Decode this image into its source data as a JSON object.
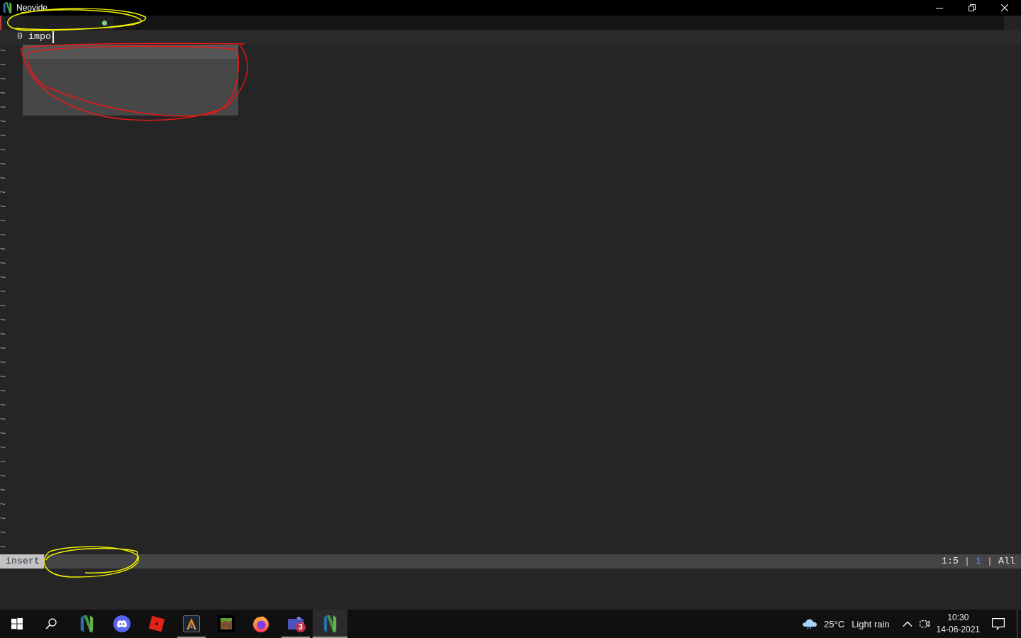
{
  "window": {
    "title": "Neovide"
  },
  "tabline": {
    "tabs": [
      {
        "selected": true,
        "modified": true
      }
    ]
  },
  "buffer": {
    "lines": [
      {
        "number": "0",
        "text": "impo",
        "cursor": true
      }
    ],
    "filler": [
      "~",
      "~",
      "~",
      "~",
      "~",
      "~",
      "~",
      "~",
      "~",
      "~",
      "~",
      "~",
      "~",
      "~",
      "~",
      "~",
      "~",
      "~",
      "~",
      "~",
      "~",
      "~",
      "~",
      "~",
      "~",
      "~",
      "~",
      "~",
      "~",
      "~",
      "~",
      "~",
      "~",
      "~",
      "~",
      "~"
    ]
  },
  "completion_menu": {
    "items": [
      {
        "selected": true
      },
      {
        "selected": false
      },
      {
        "selected": false
      },
      {
        "selected": false
      },
      {
        "selected": false
      }
    ]
  },
  "status_line": {
    "mode": "insert",
    "segments": [
      {
        "kind": "position",
        "text": "1:5"
      },
      {
        "kind": "separator",
        "text": "|"
      },
      {
        "kind": "count",
        "text": "1"
      },
      {
        "kind": "separator",
        "text": "|"
      },
      {
        "kind": "percent",
        "text": "All"
      }
    ]
  },
  "taskbar": {
    "apps": [
      {
        "running": false,
        "active": false
      },
      {
        "running": false,
        "active": false
      },
      {
        "running": false,
        "active": false
      },
      {
        "running": true,
        "active": false
      },
      {
        "running": false,
        "active": false
      },
      {
        "running": false,
        "active": false
      },
      {
        "running": true,
        "active": false,
        "badge": "3"
      },
      {
        "running": true,
        "active": true
      }
    ],
    "weather": {
      "temperature": "25°C",
      "condition": "Light rain"
    },
    "clock": {
      "time": "10:30",
      "date": "14-06-2021"
    }
  },
  "annotations": [
    {
      "color": "#f0f000"
    },
    {
      "color": "#e81818"
    },
    {
      "color": "#f0f000"
    }
  ]
}
